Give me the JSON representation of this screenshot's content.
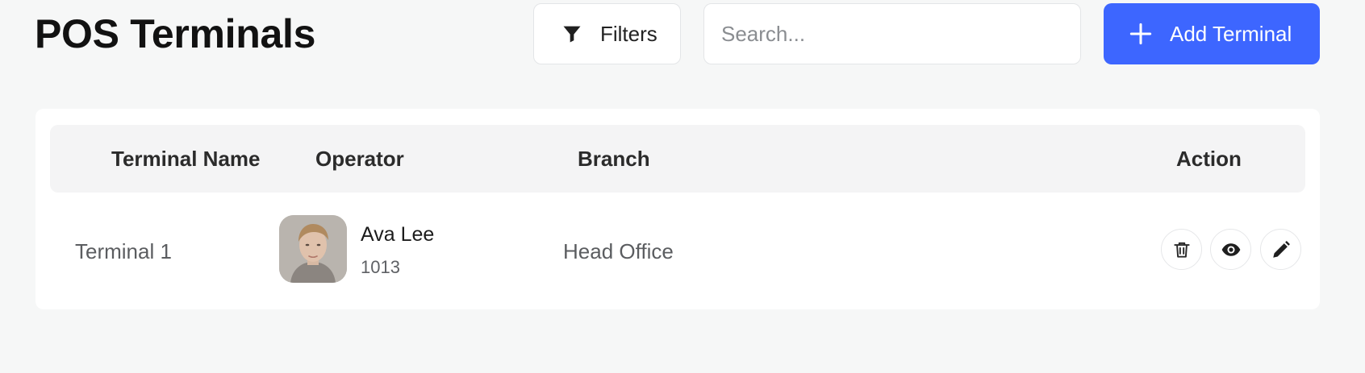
{
  "header": {
    "title": "POS Terminals",
    "filters_label": "Filters",
    "search_placeholder": "Search...",
    "add_label": "Add Terminal"
  },
  "colors": {
    "accent": "#3d66ff",
    "page_background": "#f6f7f7",
    "card_background": "#ffffff"
  },
  "icons": {
    "filters": "filter-funnel-icon",
    "add": "plus-icon",
    "delete": "trash-icon",
    "view": "eye-icon",
    "edit": "pencil-icon"
  },
  "table": {
    "columns": [
      "Terminal Name",
      "Operator",
      "Branch",
      "Action"
    ],
    "rows": [
      {
        "terminal_name": "Terminal 1",
        "operator": {
          "name": "Ava Lee",
          "id": "1013"
        },
        "branch": "Head Office"
      }
    ]
  }
}
